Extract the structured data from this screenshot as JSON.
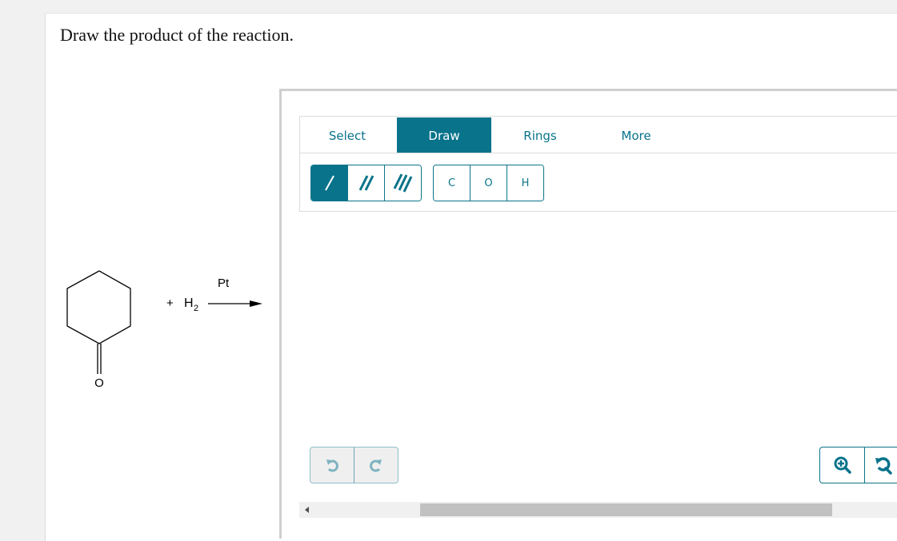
{
  "question": {
    "prompt": "Draw the product of the reaction."
  },
  "reaction": {
    "reactant": "cyclohexanone",
    "reactant_atom_label": "O",
    "reagent_plus": "+",
    "reagent": "H",
    "reagent_subscript": "2",
    "catalyst": "Pt",
    "arrow": "reaction-arrow"
  },
  "editor": {
    "tabs": [
      {
        "label": "Select",
        "active": false
      },
      {
        "label": "Draw",
        "active": true
      },
      {
        "label": "Rings",
        "active": false
      },
      {
        "label": "More",
        "active": false
      }
    ],
    "bond_tools": [
      {
        "name": "single-bond",
        "active": true
      },
      {
        "name": "double-bond",
        "active": false
      },
      {
        "name": "triple-bond",
        "active": false
      }
    ],
    "atom_tools": [
      "C",
      "O",
      "H"
    ],
    "history_tools": [
      "undo",
      "redo"
    ],
    "view_tools": [
      "zoom-in",
      "reset-zoom"
    ],
    "colors": {
      "accent": "#08738b",
      "disabled_icon": "#7fb3c0"
    }
  }
}
